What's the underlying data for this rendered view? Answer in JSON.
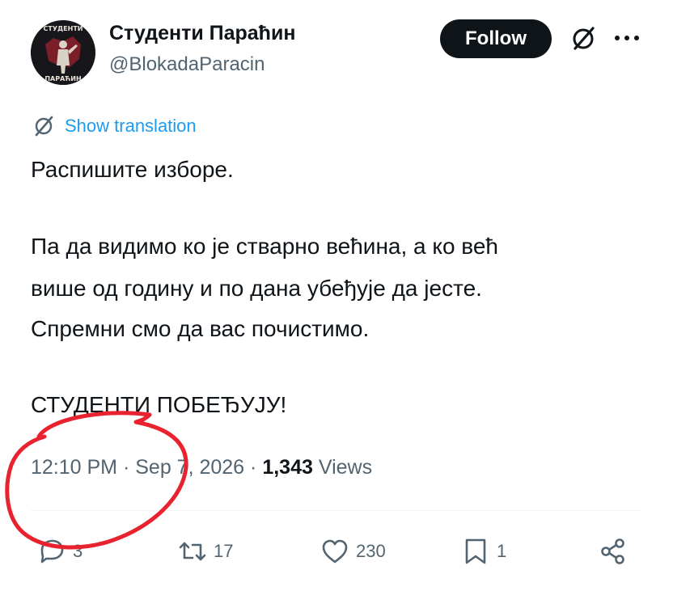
{
  "author": {
    "display_name": "Студенти Параћин",
    "handle": "@BlokadaParacin",
    "avatar_text_top": "СТУДЕНТИ",
    "avatar_text_bottom": "ПАРАЋИН"
  },
  "header": {
    "follow_label": "Follow",
    "grok_icon": "grok-icon",
    "more_icon": "more-dots-icon"
  },
  "translation": {
    "label": "Show translation",
    "icon": "translate-icon"
  },
  "tweet": {
    "lines": [
      "Распишите изборе.",
      "Па да видимо ко је стварно већина, а ко већ",
      "више од годину и по дана убеђује да јесте.",
      "Спремни смо да вас почистимо.",
      "СТУДЕНТИ ПОБЕЂУЈУ!"
    ]
  },
  "meta": {
    "time": "12:10 PM",
    "date": "Sep 7, 2026",
    "views_count": "1,343",
    "views_label": "Views",
    "separator": "·"
  },
  "actions": {
    "replies": "3",
    "reposts": "17",
    "likes": "230",
    "bookmarks": "1"
  },
  "colors": {
    "accent": "#1d9bf0",
    "text": "#0f1419",
    "muted": "#536471",
    "annotation": "#e8232f"
  }
}
